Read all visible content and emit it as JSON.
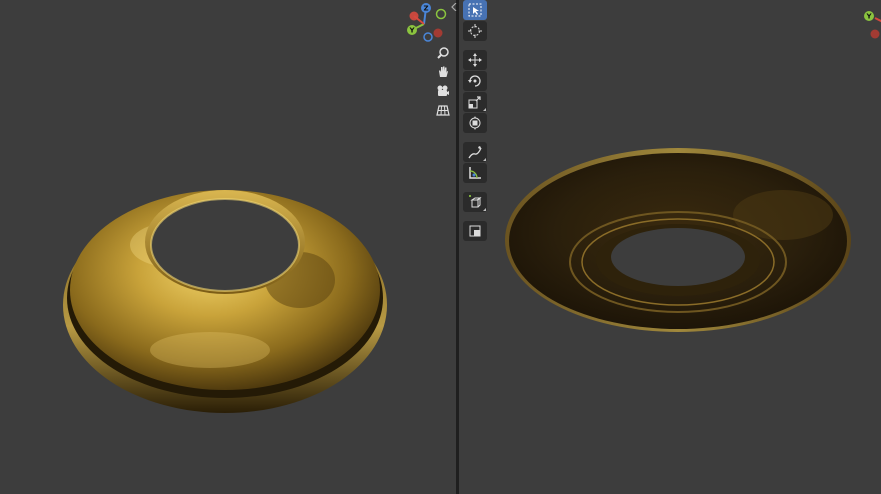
{
  "viewports": {
    "left": {
      "gizmo": {
        "axes": [
          "Z",
          "Y"
        ]
      },
      "nav_icons": [
        "zoom-icon",
        "hand-pan-icon",
        "camera-icon",
        "grid-ortho-icon"
      ]
    },
    "right": {
      "gizmo": {
        "axes": [
          "Y"
        ]
      }
    }
  },
  "toolbar": {
    "tools": [
      "select-box-tool",
      "cursor-tool",
      "move-tool",
      "rotate-tool",
      "scale-tool",
      "transform-tool",
      "annotate-tool",
      "measure-tool",
      "add-cube-tool",
      "extrude-tool"
    ]
  },
  "colors": {
    "background": "#3d3d3d",
    "axis_x": "#d6493e",
    "axis_y": "#8bc43f",
    "axis_z": "#4a86d9",
    "active_tool": "#4772b3",
    "gold_object": "#b08a2a",
    "dark_gold_object": "#2a1f0c"
  }
}
